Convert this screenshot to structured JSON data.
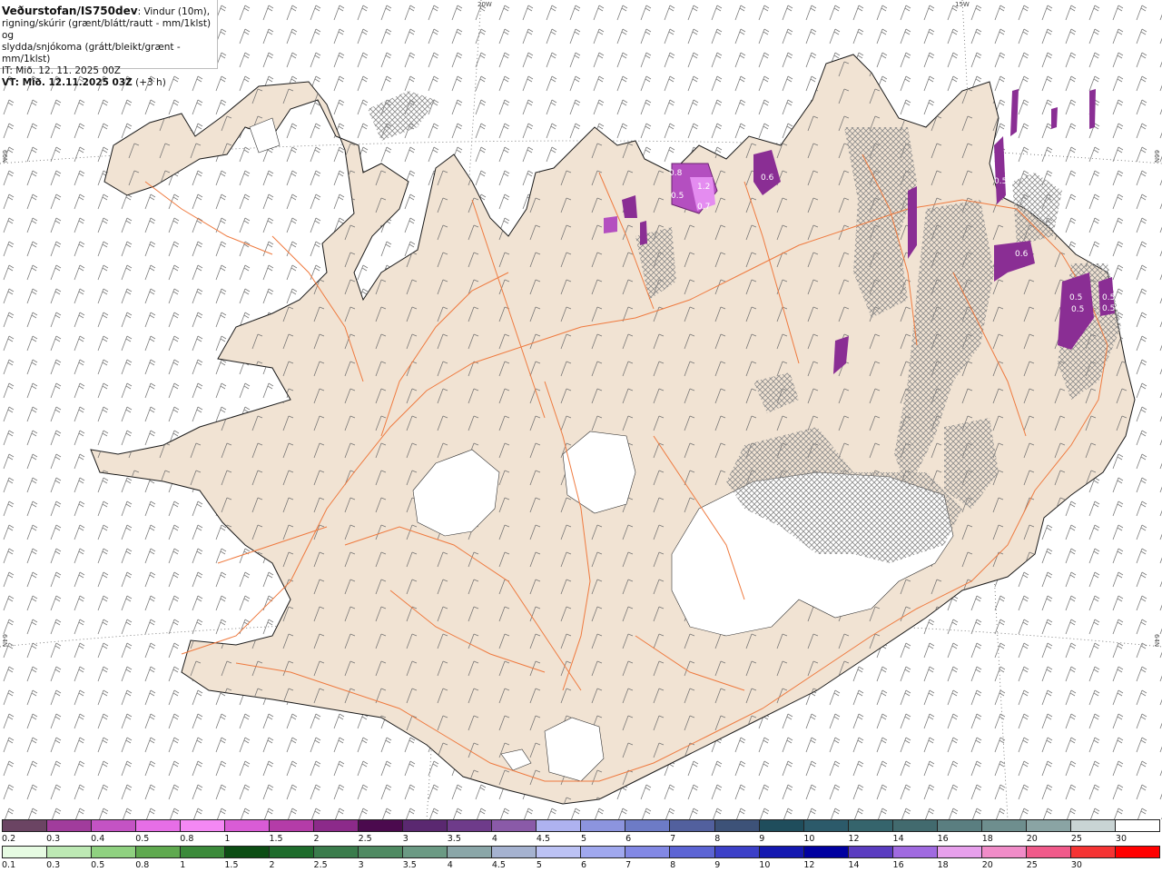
{
  "title": {
    "source": "Veðurstofan/IS750dev",
    "description_line1": ": Vindur (10m),",
    "description_line2": "rigning/skúrir (grænt/blátt/rautt - mm/1klst) og",
    "description_line3": "slydda/snjókoma (grátt/bleikt/grænt - mm/1klst)",
    "it_label": "IT: Mið. 12. 11. 2025 00Z",
    "vt_label": "VT: Mið. 12.11.2025 03Z",
    "vt_offset": "(+3 h)"
  },
  "grid_labels": {
    "top_20w": "20W",
    "top_15w": "15W",
    "left_66n": "66N",
    "left_64n": "64N",
    "right_66n": "66N",
    "right_64n": "64N"
  },
  "precip_labels": [
    "0.8",
    "1.2",
    "0.5",
    "0.7",
    "0.6",
    "0.5",
    "0.6",
    "0.5",
    "0.5",
    "0.5",
    "0.5"
  ],
  "colors": {
    "land": "#f1e3d3",
    "glacier": "#ffffff",
    "roads": "#ef7a3f",
    "coast": "#1a1a1a",
    "snow_dark": "#7a2a7e",
    "snow_mid": "#b44fc0",
    "snow_light": "#e48cf0"
  },
  "legend_snow": {
    "ticks": [
      "0.2",
      "0.3",
      "0.4",
      "0.5",
      "0.8",
      "1",
      "1.5",
      "2",
      "2.5",
      "3",
      "3.5",
      "4",
      "4.5",
      "5",
      "6",
      "7",
      "8",
      "9",
      "10",
      "12",
      "14",
      "16",
      "18",
      "20",
      "25",
      "30"
    ],
    "colors": [
      "#6b4463",
      "#a13c9c",
      "#c453c4",
      "#e66ee6",
      "#f488f4",
      "#d95cd6",
      "#b43ca8",
      "#8c2a8a",
      "#4b0a4e",
      "#5a2870",
      "#6e3b8a",
      "#8a5aa8",
      "#aeb2f0",
      "#8c94de",
      "#6d7bc6",
      "#52609e",
      "#3d5278",
      "#1f4d5c",
      "#2c5a6a",
      "#35646c",
      "#426a6e",
      "#5a7e80",
      "#6e8e8e",
      "#8aa4a4",
      "#c9d4d4",
      "#ffffff"
    ]
  },
  "legend_rain": {
    "ticks": [
      "0.1",
      "0.3",
      "0.5",
      "0.8",
      "1",
      "1.5",
      "2",
      "2.5",
      "3",
      "3.5",
      "4",
      "4.5",
      "5",
      "6",
      "7",
      "8",
      "9",
      "10",
      "12",
      "14",
      "16",
      "18",
      "20",
      "25",
      "30"
    ],
    "colors": [
      "#e6fbe2",
      "#bde9b4",
      "#8fd180",
      "#5fa94f",
      "#3b8a3a",
      "#0c4d14",
      "#1e6c2c",
      "#3a7c4c",
      "#4f8a62",
      "#6b9a84",
      "#8aa6a8",
      "#a5b2d0",
      "#bcc2f4",
      "#a0a8ee",
      "#8288e4",
      "#5c64d4",
      "#3c40c8",
      "#1418b0",
      "#0000a0",
      "#5a3cc0",
      "#a06ae0",
      "#e7a0ec",
      "#f08cc8",
      "#f05a8a",
      "#f53434",
      "#ff0000"
    ]
  }
}
